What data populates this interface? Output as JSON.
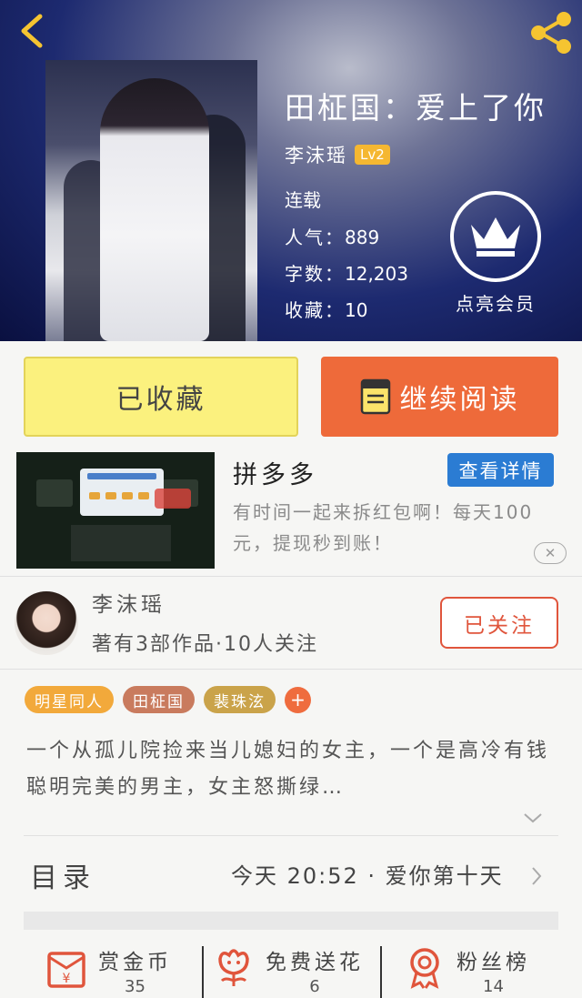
{
  "header": {
    "book_title": "田柾国：爱上了你",
    "author": "李沫瑶",
    "level_badge": "Lv2",
    "status": "连载",
    "popularity_label": "人气：",
    "popularity_value": "889",
    "word_count_label": "字数：",
    "word_count_value": "12,203",
    "favorites_label": "收藏：",
    "favorites_value": "10",
    "vip_label": "点亮会员"
  },
  "buttons": {
    "favorited": "已收藏",
    "continue_reading": "继续阅读"
  },
  "ad": {
    "title": "拼多多",
    "detail_button": "查看详情",
    "description": "有时间一起来拆红包啊！每天100元，提现秒到账！"
  },
  "author_card": {
    "name": "李沫瑶",
    "info": "著有3部作品·10人关注",
    "follow_button": "已关注"
  },
  "tags": [
    {
      "label": "明星同人",
      "color": "#f2a93b"
    },
    {
      "label": "田柾国",
      "color": "#c97b5e"
    },
    {
      "label": "裴珠泫",
      "color": "#caa34a"
    }
  ],
  "tag_add": "+",
  "synopsis": "一个从孤儿院捡来当儿媳妇的女主，一个是高冷有钱聪明完美的男主，女主怒撕绿…",
  "toc": {
    "title": "目录",
    "latest": "今天 20:52 · 爱你第十天"
  },
  "actions": [
    {
      "label": "赏金币",
      "count": "35",
      "icon": "red-envelope-icon"
    },
    {
      "label": "免费送花",
      "count": "6",
      "icon": "flower-icon"
    },
    {
      "label": "粉丝榜",
      "count": "14",
      "icon": "medal-icon"
    }
  ],
  "colors": {
    "accent_orange": "#ee6a3a",
    "favorite_yellow": "#fbf17e",
    "follow_red": "#e0553c",
    "ad_blue": "#2b7cd3"
  }
}
